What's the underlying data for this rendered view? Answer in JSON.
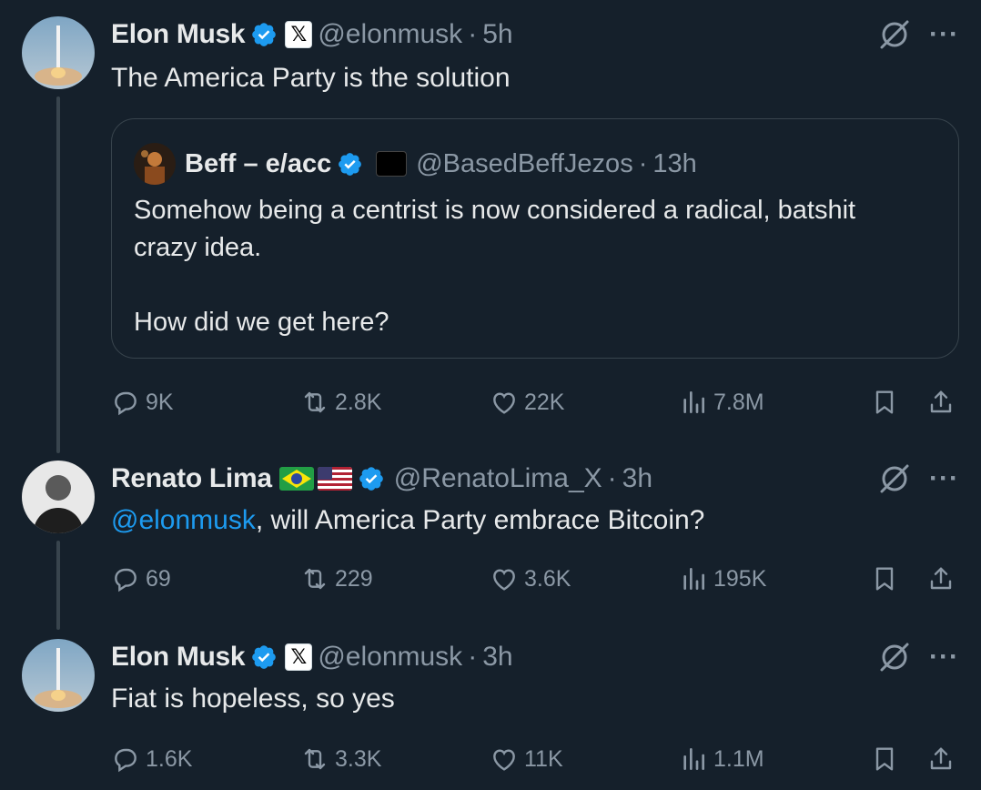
{
  "tweets": [
    {
      "name": "Elon Musk",
      "handle": "@elonmusk",
      "time": "5h",
      "text": "The America Party is the solution",
      "quote": {
        "name": "Beff – e/acc",
        "handle": "@BasedBeffJezos",
        "time": "13h",
        "lines": [
          "Somehow being a centrist is now considered a radical, batshit",
          "crazy idea.",
          "",
          "How did we get here?"
        ]
      },
      "replies": "9K",
      "reposts": "2.8K",
      "likes": "22K",
      "views": "7.8M"
    },
    {
      "name": "Renato Lima",
      "handle": "@RenatoLima_X",
      "time": "3h",
      "mention": "@elonmusk",
      "text": ", will America Party embrace Bitcoin?",
      "replies": "69",
      "reposts": "229",
      "likes": "3.6K",
      "views": "195K"
    },
    {
      "name": "Elon Musk",
      "handle": "@elonmusk",
      "time": "3h",
      "text": "Fiat is hopeless, so yes",
      "replies": "1.6K",
      "reposts": "3.3K",
      "likes": "11K",
      "views": "1.1M"
    }
  ],
  "separator": "·",
  "more": "···",
  "x_badge": "𝕏",
  "colors": {
    "background": "#15202b",
    "verified": "#1d9bf0",
    "muted": "#8b98a5",
    "text": "#e7e9ea",
    "mention": "#1d9bf0"
  },
  "icons": [
    "verified-badge-icon",
    "x-affiliate-icon",
    "grok-icon",
    "more-icon",
    "reply-icon",
    "repost-icon",
    "like-icon",
    "views-icon",
    "bookmark-icon",
    "share-icon",
    "brazil-flag-icon",
    "usa-flag-icon"
  ]
}
